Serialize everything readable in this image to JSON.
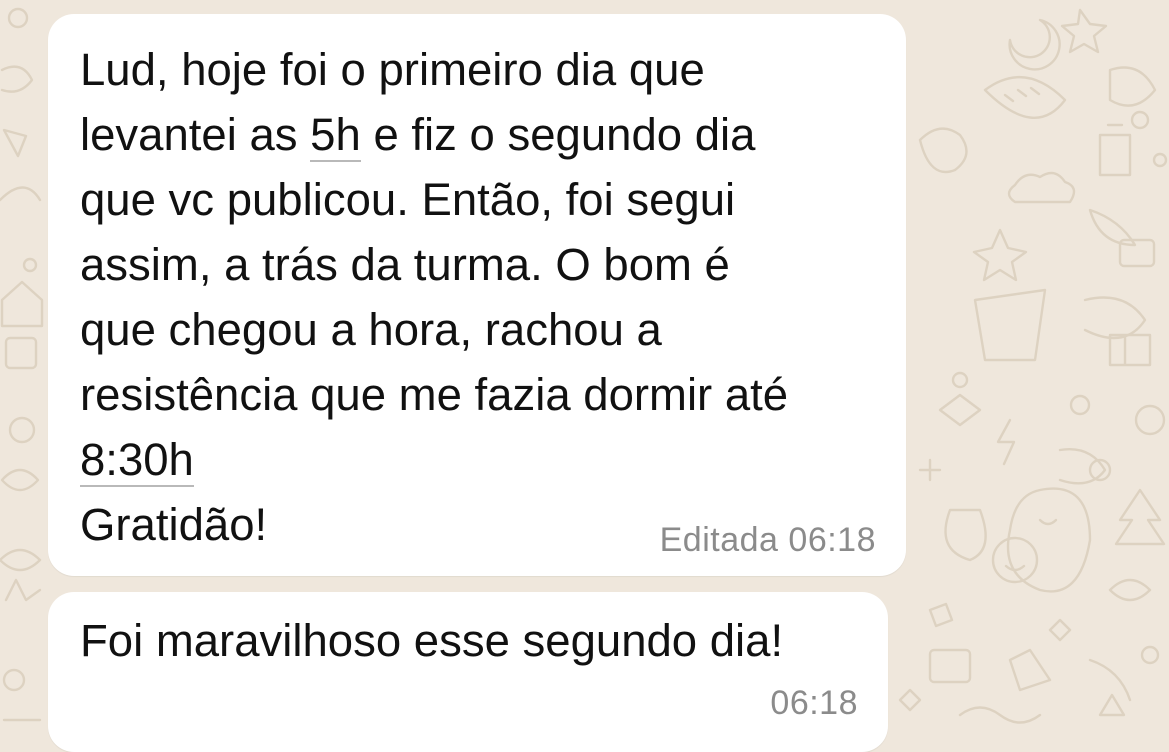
{
  "chat": {
    "background_color": "#efe7dc",
    "messages": [
      {
        "lines": [
          "Lud, hoje foi o primeiro dia que",
          "levantei as ",
          "5h",
          " e fiz o segundo dia",
          "que vc publicou. Então, foi segui",
          "assim, a trás da turma. O bom é",
          "que chegou a hora, rachou a",
          "resistência que me fazia dormir até",
          "8:30h",
          "Gratidão!"
        ],
        "status": "Editada",
        "time": "06:18"
      },
      {
        "lines": [
          "Foi maravilhoso esse segundo dia!"
        ],
        "time": "06:18"
      }
    ]
  }
}
